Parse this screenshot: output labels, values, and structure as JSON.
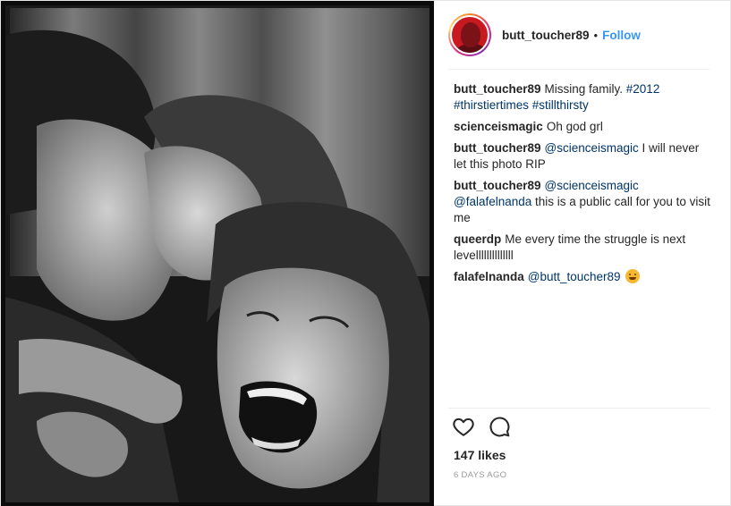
{
  "post": {
    "author": {
      "handle": "butt_toucher89",
      "separator": "•",
      "follow_label": "Follow"
    },
    "icons": {
      "avatar": "profile-photo",
      "like": "heart-outline-icon",
      "comment": "speech-bubble-icon"
    },
    "comments": [
      {
        "user": "butt_toucher89",
        "text": "Missing family. ",
        "tags": [
          "#2012",
          "#thirstiertimes",
          "#stillthirsty"
        ]
      },
      {
        "user": "scienceismagic",
        "text": "Oh god grl"
      },
      {
        "user": "butt_toucher89",
        "mention": "@scienceismagic",
        "text": " I will never let this photo RIP"
      },
      {
        "user": "butt_toucher89",
        "mention": "@scienceismagic",
        "mention2": "@falafelnanda",
        "text": " this is a public call for you to visit me"
      },
      {
        "user": "queerdp",
        "text": "Me every time the struggle is next levellllllllllllll"
      },
      {
        "user": "falafelnanda",
        "mention": "@butt_toucher89",
        "emoji": "hugging-face-emoji"
      }
    ],
    "likes": "147 likes",
    "timestamp": "6 DAYS AGO",
    "colors": {
      "link_blue": "#3897f0",
      "tag_blue": "#003569",
      "text": "#262626",
      "muted": "#999999"
    }
  }
}
